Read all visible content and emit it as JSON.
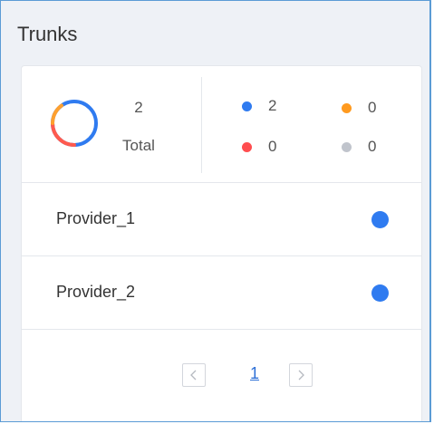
{
  "panel": {
    "title": "Trunks"
  },
  "summary": {
    "total_count": "2",
    "total_label": "Total",
    "stats": [
      {
        "status": "blue",
        "value": "2",
        "color": "#2f7bf0"
      },
      {
        "status": "orange",
        "value": "0",
        "color": "#ff9a1f"
      },
      {
        "status": "red",
        "value": "0",
        "color": "#ff4d4f"
      },
      {
        "status": "gray",
        "value": "0",
        "color": "#c0c4cc"
      }
    ]
  },
  "trunks": [
    {
      "name": "Provider_1",
      "status_color": "#2f7bf0"
    },
    {
      "name": "Provider_2",
      "status_color": "#2f7bf0"
    }
  ],
  "pagination": {
    "prev_icon": "chevron-left-icon",
    "current_page": "1",
    "next_icon": "chevron-right-icon"
  }
}
